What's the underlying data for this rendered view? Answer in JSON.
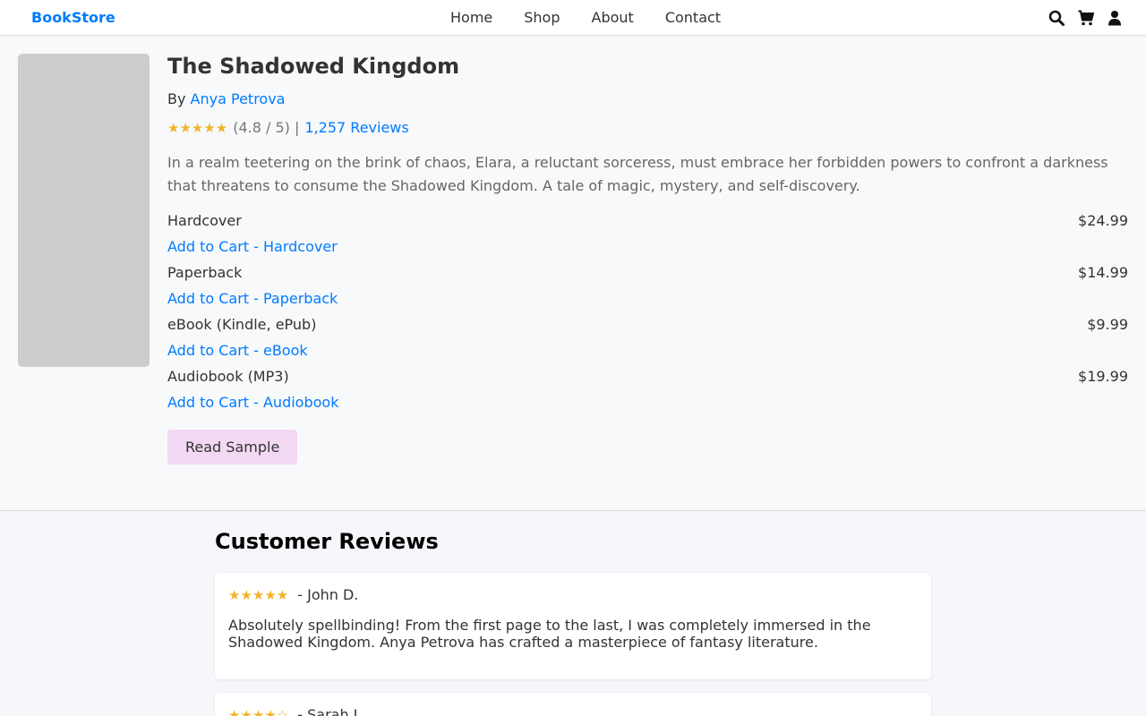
{
  "header": {
    "brand": "BookStore",
    "nav": [
      "Home",
      "Shop",
      "About",
      "Contact"
    ],
    "icons": [
      "search-icon",
      "cart-icon",
      "user-icon"
    ]
  },
  "book": {
    "title": "The Shadowed Kingdom",
    "by_label": "By",
    "author": "Anya Petrova",
    "stars": "★★★★★",
    "rating_text": "(4.8 / 5) |",
    "reviews_link": "1,257 Reviews",
    "description": "In a realm teetering on the brink of chaos, Elara, a reluctant sorceress, must embrace her forbidden powers to confront a darkness that threatens to consume the Shadowed Kingdom. A tale of magic, mystery, and self-discovery.",
    "formats": [
      {
        "name": "Hardcover",
        "price": "$24.99",
        "cta": "Add to Cart - Hardcover"
      },
      {
        "name": "Paperback",
        "price": "$14.99",
        "cta": "Add to Cart - Paperback"
      },
      {
        "name": "eBook (Kindle, ePub)",
        "price": "$9.99",
        "cta": "Add to Cart - eBook"
      },
      {
        "name": "Audiobook (MP3)",
        "price": "$19.99",
        "cta": "Add to Cart - Audiobook"
      }
    ],
    "sample_button": "Read Sample"
  },
  "reviews": {
    "title": "Customer Reviews",
    "items": [
      {
        "stars": "★★★★★",
        "author": "- John D.",
        "text": "Absolutely spellbinding! From the first page to the last, I was completely immersed in the Shadowed Kingdom. Anya Petrova has crafted a masterpiece of fantasy literature."
      },
      {
        "stars": "★★★★☆",
        "author": "- Sarah L."
      }
    ]
  },
  "colors": {
    "accent": "#007bff",
    "star": "#f0b429",
    "sample_button_bg": "#f3d8f3"
  }
}
